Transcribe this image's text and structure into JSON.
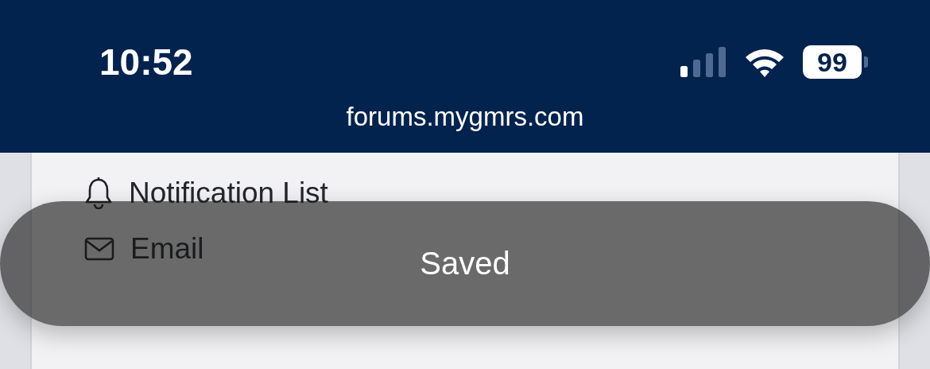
{
  "status_bar": {
    "time": "10:52",
    "battery": "99"
  },
  "address_bar": {
    "url": "forums.mygmrs.com"
  },
  "menu": {
    "items": [
      {
        "kind": "bell",
        "label": "Notification List"
      },
      {
        "kind": "mail",
        "label": "Email"
      }
    ]
  },
  "toast": {
    "message": "Saved"
  }
}
